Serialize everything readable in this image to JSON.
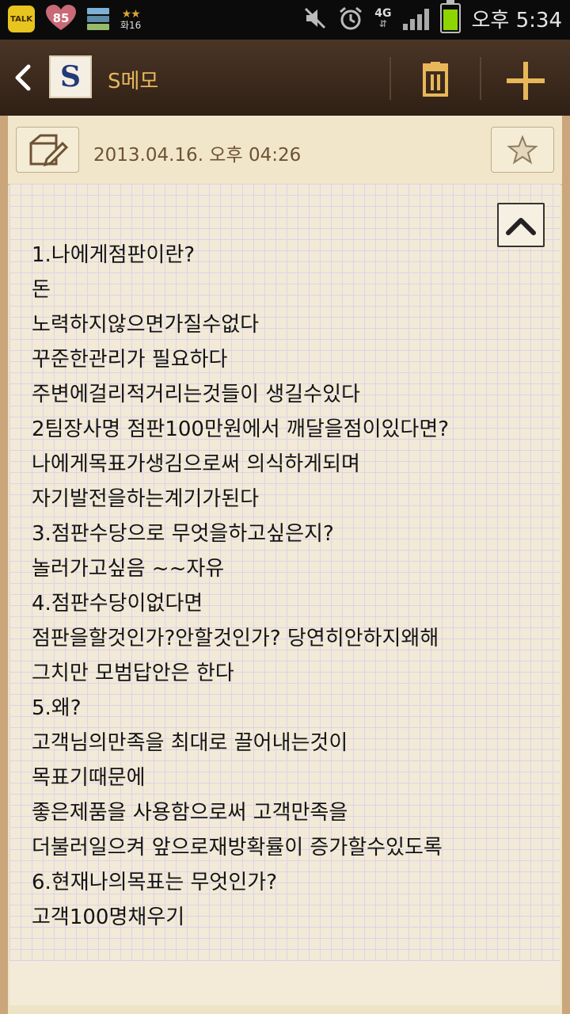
{
  "status_bar": {
    "talk_label": "TALK",
    "heart_badge": "85",
    "stars_label": "화16",
    "network": "4G",
    "time": "오후 5:34",
    "battery_color": "#8dd400"
  },
  "app_bar": {
    "logo_letter": "S",
    "title": "S메모"
  },
  "note": {
    "date": "2013.04.16. 오후 04:26",
    "lines": [
      "1.나에게점판이란?",
      "돈",
      "노력하지않으면가질수없다",
      "꾸준한관리가 필요하다",
      "주변에걸리적거리는것들이 생길수있다",
      "2팀장사명 점판100만원에서 깨달을점이있다면?",
      "나에게목표가생김으로써 의식하게되며",
      "자기발전을하는계기가된다",
      "3.점판수당으로 무엇을하고싶은지?",
      "놀러가고싶음 ~~자유",
      "4.점판수당이없다면",
      "점판을할것인가?안할것인가? 당연히안하지왜해",
      "그치만 모범답안은 한다",
      "5.왜?",
      "고객님의만족을 최대로 끌어내는것이",
      "목표기때문에",
      "좋은제품을 사용함으로써 고객만족을",
      "더불러일으켜 앞으로재방확률이 증가할수있도록",
      "6.현재나의목표는 무엇인가?",
      "고객100명채우기"
    ]
  },
  "colors": {
    "accent": "#e8b75a",
    "paper": "#efe3c6",
    "grid": "#ddd3ea",
    "date_text": "#6e5234"
  }
}
